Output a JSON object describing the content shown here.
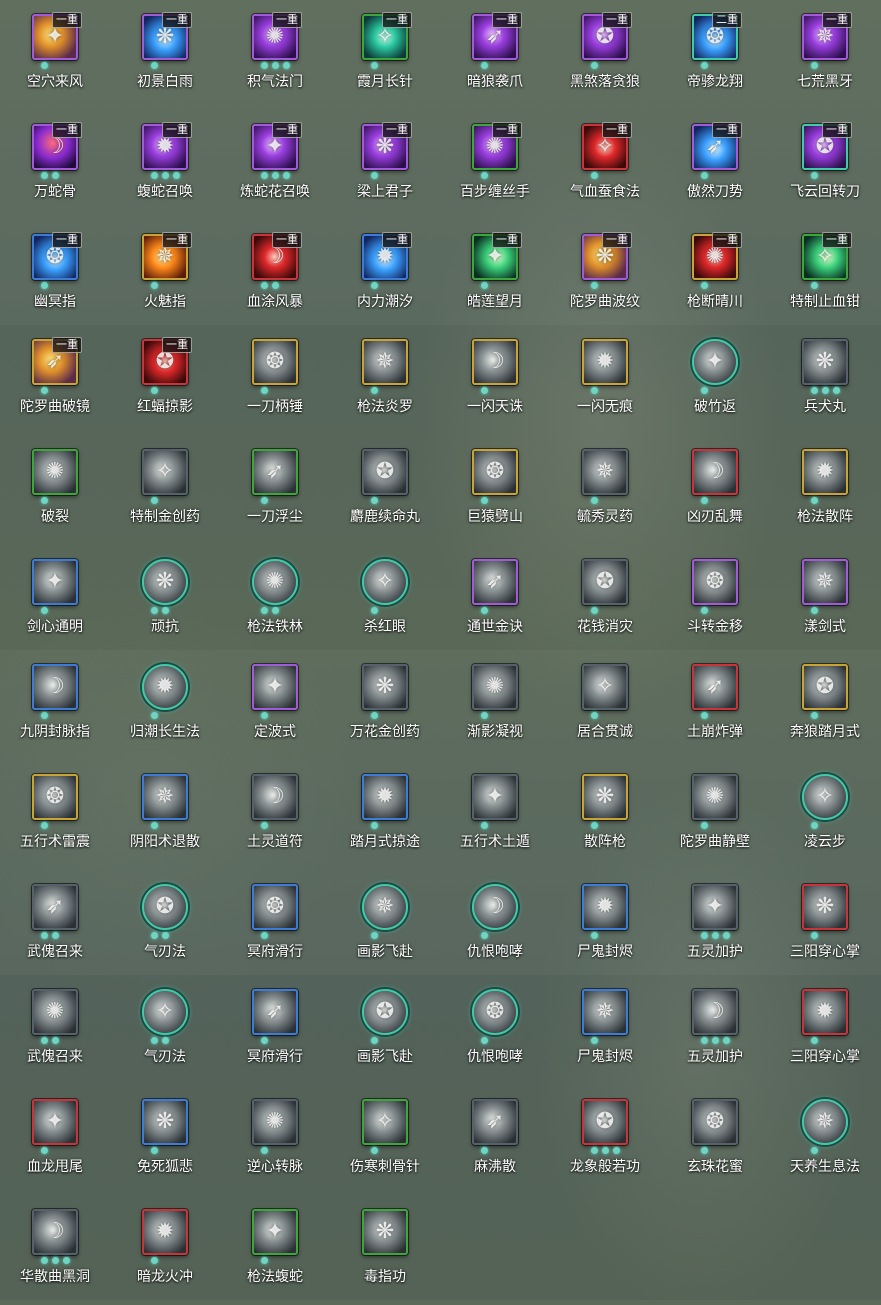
{
  "colors": {
    "frame_purple": "#a35ad8",
    "frame_blue": "#3d7cd6",
    "frame_green": "#3ea53a",
    "frame_red": "#c8343a",
    "frame_gold": "#c9a334",
    "frame_teal": "#3fcaa8",
    "frame_gray": "#55626c",
    "dot_teal": "#6fd4c2"
  },
  "rows": [
    {
      "skills": [
        {
          "name": "空穴来风",
          "rank": "一重",
          "frame": "purple",
          "art": "gold",
          "dots": 1,
          "icon": "vortex-icon"
        },
        {
          "name": "初景白雨",
          "rank": "一重",
          "frame": "purple",
          "art": "blue",
          "dots": 1,
          "icon": "rain-icon"
        },
        {
          "name": "积气法门",
          "rank": "一重",
          "frame": "purple",
          "art": "purple",
          "dots": 3,
          "icon": "energy-icon"
        },
        {
          "name": "霞月长针",
          "rank": "一重",
          "frame": "green",
          "art": "teal",
          "dots": 1,
          "icon": "needle-icon"
        },
        {
          "name": "暗狼袭爪",
          "rank": "一重",
          "frame": "purple",
          "art": "purple",
          "dots": 1,
          "icon": "claw-icon"
        },
        {
          "name": "黑煞落贪狼",
          "rank": "一重",
          "frame": "purple",
          "art": "purple",
          "dots": 1,
          "icon": "wolf-icon"
        },
        {
          "name": "帝骖龙翔",
          "rank": "二重",
          "frame": "teal",
          "art": "blue",
          "dots": 1,
          "icon": "dragon-icon"
        },
        {
          "name": "七荒黑牙",
          "rank": "一重",
          "frame": "purple",
          "art": "purple",
          "dots": 1,
          "icon": "fang-icon"
        }
      ]
    },
    {
      "skills": [
        {
          "name": "万蛇骨",
          "rank": "一重",
          "frame": "purple",
          "art": "red-purple",
          "dots": 2,
          "icon": "snake-bone-icon"
        },
        {
          "name": "蝮蛇召唤",
          "rank": "一重",
          "frame": "purple",
          "art": "purple",
          "dots": 3,
          "icon": "serpent-icon"
        },
        {
          "name": "炼蛇花召唤",
          "rank": "一重",
          "frame": "purple",
          "art": "purple",
          "dots": 3,
          "icon": "flower-snake-icon"
        },
        {
          "name": "梁上君子",
          "rank": "一重",
          "frame": "purple",
          "art": "purple",
          "dots": 1,
          "icon": "thief-icon"
        },
        {
          "name": "百步缠丝手",
          "rank": "一重",
          "frame": "green",
          "art": "purple",
          "dots": 1,
          "icon": "silk-hand-icon"
        },
        {
          "name": "气血蚕食法",
          "rank": "一重",
          "frame": "red",
          "art": "red",
          "dots": 1,
          "icon": "blood-icon"
        },
        {
          "name": "傲然刀势",
          "rank": "一重",
          "frame": "purple",
          "art": "blue",
          "dots": 1,
          "icon": "blade-icon"
        },
        {
          "name": "飞云回转刀",
          "rank": "一重",
          "frame": "teal",
          "art": "purple",
          "dots": 1,
          "icon": "spin-blade-icon"
        }
      ]
    },
    {
      "skills": [
        {
          "name": "幽冥指",
          "rank": "一重",
          "frame": "blue",
          "art": "blue",
          "dots": 1,
          "icon": "finger-icon"
        },
        {
          "name": "火魅指",
          "rank": "一重",
          "frame": "gold",
          "art": "orange",
          "dots": 1,
          "icon": "fire-finger-icon"
        },
        {
          "name": "血涂风暴",
          "rank": "一重",
          "frame": "red",
          "art": "red",
          "dots": 2,
          "icon": "blood-storm-icon"
        },
        {
          "name": "内力潮汐",
          "rank": "一重",
          "frame": "blue",
          "art": "blue",
          "dots": 1,
          "icon": "tide-icon"
        },
        {
          "name": "皓莲望月",
          "rank": "一重",
          "frame": "green",
          "art": "green",
          "dots": 1,
          "icon": "moon-icon"
        },
        {
          "name": "陀罗曲波纹",
          "rank": "一重",
          "frame": "purple",
          "art": "gold",
          "dots": 1,
          "icon": "ripple-icon"
        },
        {
          "name": "枪断晴川",
          "rank": "一重",
          "frame": "gold",
          "art": "red",
          "dots": 1,
          "icon": "spear-icon"
        },
        {
          "name": "特制止血钳",
          "rank": "一重",
          "frame": "green",
          "art": "green",
          "dots": 1,
          "icon": "clamp-icon"
        }
      ]
    },
    {
      "skills": [
        {
          "name": "陀罗曲破镜",
          "rank": "一重",
          "frame": "gold",
          "art": "gold",
          "dots": 1,
          "icon": "mirror-icon"
        },
        {
          "name": "红蝠掠影",
          "rank": "一重",
          "frame": "red",
          "art": "red",
          "dots": 1,
          "icon": "bat-icon"
        },
        {
          "name": "一刀柄锤",
          "rank": "",
          "frame": "gold",
          "art": "gray",
          "dots": 1,
          "icon": "hammer-icon"
        },
        {
          "name": "枪法炎罗",
          "rank": "",
          "frame": "gold",
          "art": "gray",
          "dots": 1,
          "icon": "spear-flame-icon"
        },
        {
          "name": "一闪天诛",
          "rank": "",
          "frame": "gold",
          "art": "gray",
          "dots": 1,
          "icon": "flash-strike-icon"
        },
        {
          "name": "一闪无痕",
          "rank": "",
          "frame": "gold",
          "art": "gray",
          "dots": 1,
          "icon": "slash-icon"
        },
        {
          "name": "破竹返",
          "rank": "",
          "frame": "round",
          "art": "gray",
          "dots": 1,
          "icon": "bamboo-icon"
        },
        {
          "name": "兵犬丸",
          "rank": "",
          "frame": "gray",
          "art": "gray",
          "dots": 3,
          "icon": "pill-icon"
        }
      ]
    },
    {
      "skills": [
        {
          "name": "破裂",
          "rank": "",
          "frame": "green",
          "art": "gray",
          "dots": 1,
          "icon": "crack-icon"
        },
        {
          "name": "特制金创药",
          "rank": "",
          "frame": "gray",
          "art": "gray",
          "dots": 1,
          "icon": "medicine-jar-icon"
        },
        {
          "name": "一刀浮尘",
          "rank": "",
          "frame": "green",
          "art": "gray",
          "dots": 1,
          "icon": "dust-slash-icon"
        },
        {
          "name": "麝鹿续命丸",
          "rank": "",
          "frame": "gray",
          "art": "gray",
          "dots": 1,
          "icon": "deer-pill-icon"
        },
        {
          "name": "巨猿劈山",
          "rank": "",
          "frame": "gold",
          "art": "gray",
          "dots": 1,
          "icon": "ape-icon"
        },
        {
          "name": "毓秀灵药",
          "rank": "",
          "frame": "gray",
          "art": "gray",
          "dots": 1,
          "icon": "gourd-icon"
        },
        {
          "name": "凶刃乱舞",
          "rank": "",
          "frame": "red",
          "art": "gray",
          "dots": 1,
          "icon": "blades-icon"
        },
        {
          "name": "枪法散阵",
          "rank": "",
          "frame": "gold",
          "art": "gray",
          "dots": 1,
          "icon": "spear-scatter-icon"
        }
      ]
    },
    {
      "skills": [
        {
          "name": "剑心通明",
          "rank": "",
          "frame": "blue",
          "art": "gray",
          "dots": 1,
          "icon": "sword-heart-icon"
        },
        {
          "name": "顽抗",
          "rank": "",
          "frame": "round",
          "art": "gray",
          "dots": 2,
          "icon": "resist-icon"
        },
        {
          "name": "枪法铁林",
          "rank": "",
          "frame": "round",
          "art": "gray",
          "dots": 2,
          "icon": "iron-forest-icon"
        },
        {
          "name": "杀红眼",
          "rank": "",
          "frame": "round",
          "art": "gray",
          "dots": 1,
          "icon": "rage-icon"
        },
        {
          "name": "通世金诀",
          "rank": "",
          "frame": "purple",
          "art": "gray",
          "dots": 1,
          "icon": "dice-icon"
        },
        {
          "name": "花钱消灾",
          "rank": "",
          "frame": "gray",
          "art": "gray",
          "dots": 1,
          "icon": "money-bag-icon"
        },
        {
          "name": "斗转金移",
          "rank": "",
          "frame": "purple",
          "art": "gray",
          "dots": 1,
          "icon": "swap-icon"
        },
        {
          "name": "漾剑式",
          "rank": "",
          "frame": "purple",
          "art": "gray",
          "dots": 1,
          "icon": "sword-wave-icon"
        }
      ]
    },
    {
      "skills": [
        {
          "name": "九阴封脉指",
          "rank": "",
          "frame": "blue",
          "art": "gray",
          "dots": 1,
          "icon": "seal-finger-icon"
        },
        {
          "name": "归潮长生法",
          "rank": "",
          "frame": "round",
          "art": "gray",
          "dots": 1,
          "icon": "longevity-icon"
        },
        {
          "name": "定波式",
          "rank": "",
          "frame": "purple",
          "art": "gray",
          "dots": 1,
          "icon": "wave-stop-icon"
        },
        {
          "name": "万花金创药",
          "rank": "",
          "frame": "gray",
          "art": "gray",
          "dots": 1,
          "icon": "flower-medicine-icon"
        },
        {
          "name": "渐影凝视",
          "rank": "",
          "frame": "gray",
          "art": "gray",
          "dots": 1,
          "icon": "gaze-icon"
        },
        {
          "name": "居合贯诚",
          "rank": "",
          "frame": "gray",
          "art": "gray",
          "dots": 1,
          "icon": "iai-icon"
        },
        {
          "name": "土崩炸弹",
          "rank": "",
          "frame": "red",
          "art": "gray",
          "dots": 1,
          "icon": "bomb-icon"
        },
        {
          "name": "奔狼踏月式",
          "rank": "",
          "frame": "gold",
          "art": "gray",
          "dots": 1,
          "icon": "running-wolf-icon"
        }
      ]
    },
    {
      "skills": [
        {
          "name": "五行术雷震",
          "rank": "",
          "frame": "gold",
          "art": "gray",
          "dots": 1,
          "icon": "thunder-icon"
        },
        {
          "name": "阴阳术退散",
          "rank": "",
          "frame": "blue",
          "art": "gray",
          "dots": 1,
          "icon": "yinyang-icon"
        },
        {
          "name": "土灵道符",
          "rank": "",
          "frame": "gray",
          "art": "gray",
          "dots": 1,
          "icon": "talisman-icon"
        },
        {
          "name": "踏月式掠途",
          "rank": "",
          "frame": "blue",
          "art": "gray",
          "dots": 1,
          "icon": "moon-step-icon"
        },
        {
          "name": "五行术土遁",
          "rank": "",
          "frame": "gray",
          "art": "gray",
          "dots": 1,
          "icon": "earth-escape-icon"
        },
        {
          "name": "散阵枪",
          "rank": "",
          "frame": "gold",
          "art": "gray",
          "dots": 1,
          "icon": "scatter-spear-icon"
        },
        {
          "name": "陀罗曲静壁",
          "rank": "",
          "frame": "gray",
          "art": "gray",
          "dots": 1,
          "icon": "wall-icon"
        },
        {
          "name": "凌云步",
          "rank": "",
          "frame": "round",
          "art": "gray",
          "dots": 1,
          "icon": "cloud-step-icon"
        }
      ]
    },
    {
      "skills": [
        {
          "name": "武傀召来",
          "rank": "",
          "frame": "gray",
          "art": "gray",
          "dots": 2,
          "icon": "puppet-icon"
        },
        {
          "name": "气刃法",
          "rank": "",
          "frame": "round",
          "art": "gray",
          "dots": 2,
          "icon": "air-blade-icon"
        },
        {
          "name": "冥府滑行",
          "rank": "",
          "frame": "blue",
          "art": "gray",
          "dots": 1,
          "icon": "underworld-slide-icon"
        },
        {
          "name": "画影飞赴",
          "rank": "",
          "frame": "round",
          "art": "gray",
          "dots": 1,
          "icon": "shadow-dash-icon"
        },
        {
          "name": "仇恨咆哮",
          "rank": "",
          "frame": "round",
          "art": "gray",
          "dots": 1,
          "icon": "roar-icon"
        },
        {
          "name": "尸鬼封烬",
          "rank": "",
          "frame": "blue",
          "art": "gray",
          "dots": 1,
          "icon": "ghost-seal-icon"
        },
        {
          "name": "五灵加护",
          "rank": "",
          "frame": "gray",
          "art": "gray",
          "dots": 3,
          "icon": "five-spirits-icon"
        },
        {
          "name": "三阳穿心掌",
          "rank": "",
          "frame": "red",
          "art": "gray",
          "dots": 1,
          "icon": "palm-icon"
        }
      ]
    },
    {
      "skills": [
        {
          "name": "武傀召来",
          "rank": "",
          "frame": "gray",
          "art": "gray",
          "dots": 2,
          "icon": "puppet-icon"
        },
        {
          "name": "气刃法",
          "rank": "",
          "frame": "round",
          "art": "gray",
          "dots": 2,
          "icon": "air-blade-icon"
        },
        {
          "name": "冥府滑行",
          "rank": "",
          "frame": "blue",
          "art": "gray",
          "dots": 1,
          "icon": "underworld-slide-icon"
        },
        {
          "name": "画影飞赴",
          "rank": "",
          "frame": "round",
          "art": "gray",
          "dots": 1,
          "icon": "shadow-dash-icon"
        },
        {
          "name": "仇恨咆哮",
          "rank": "",
          "frame": "round",
          "art": "gray",
          "dots": 1,
          "icon": "roar-icon"
        },
        {
          "name": "尸鬼封烬",
          "rank": "",
          "frame": "blue",
          "art": "gray",
          "dots": 1,
          "icon": "ghost-seal-icon"
        },
        {
          "name": "五灵加护",
          "rank": "",
          "frame": "gray",
          "art": "gray",
          "dots": 3,
          "icon": "five-spirits-icon"
        },
        {
          "name": "三阳穿心掌",
          "rank": "",
          "frame": "red",
          "art": "gray",
          "dots": 1,
          "icon": "palm-icon"
        }
      ]
    },
    {
      "skills": [
        {
          "name": "血龙甩尾",
          "rank": "",
          "frame": "red",
          "art": "gray",
          "dots": 1,
          "icon": "dragon-tail-icon"
        },
        {
          "name": "免死狐悲",
          "rank": "",
          "frame": "blue",
          "art": "gray",
          "dots": 1,
          "icon": "fox-icon"
        },
        {
          "name": "逆心转脉",
          "rank": "",
          "frame": "gray",
          "art": "gray",
          "dots": 1,
          "icon": "meridian-icon"
        },
        {
          "name": "伤寒刺骨针",
          "rank": "",
          "frame": "green",
          "art": "gray",
          "dots": 1,
          "icon": "frost-needle-icon"
        },
        {
          "name": "麻沸散",
          "rank": "",
          "frame": "gray",
          "art": "gray",
          "dots": 1,
          "icon": "powder-icon"
        },
        {
          "name": "龙象般若功",
          "rank": "",
          "frame": "red",
          "art": "gray",
          "dots": 3,
          "icon": "elephant-icon"
        },
        {
          "name": "玄珠花蜜",
          "rank": "",
          "frame": "gray",
          "art": "gray",
          "dots": 1,
          "icon": "nectar-icon"
        },
        {
          "name": "天养生息法",
          "rank": "",
          "frame": "round",
          "art": "gray",
          "dots": 1,
          "icon": "meditation-icon"
        }
      ]
    },
    {
      "skills": [
        {
          "name": "华散曲黑洞",
          "rank": "",
          "frame": "gray",
          "art": "gray",
          "dots": 3,
          "icon": "black-hole-icon"
        },
        {
          "name": "暗龙火冲",
          "rank": "",
          "frame": "red",
          "art": "gray",
          "dots": 1,
          "icon": "dark-dragon-icon"
        },
        {
          "name": "枪法蝮蛇",
          "rank": "",
          "frame": "green",
          "art": "gray",
          "dots": 1,
          "icon": "spear-viper-icon"
        },
        {
          "name": "毒指功",
          "rank": "",
          "frame": "green",
          "art": "gray",
          "dots": 0,
          "icon": "poison-finger-icon"
        }
      ]
    }
  ]
}
